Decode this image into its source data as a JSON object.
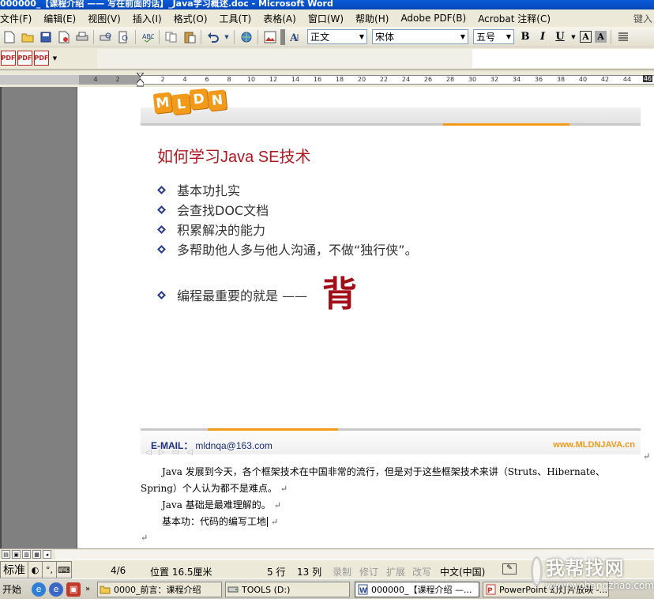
{
  "window": {
    "title": "000000_【课程介绍 —— 写在前面的话】_Java学习概述.doc - Microsoft Word"
  },
  "menu": {
    "items": [
      "文件(F)",
      "编辑(E)",
      "视图(V)",
      "插入(I)",
      "格式(O)",
      "工具(T)",
      "表格(A)",
      "窗口(W)",
      "帮助(H)",
      "Adobe PDF(B)",
      "Acrobat 注释(C)"
    ],
    "help_hint": "键入"
  },
  "toolbar": {
    "style_value": "正文",
    "font_value": "宋体",
    "size_value": "五号",
    "bold": "B",
    "italic": "I",
    "underline": "U",
    "char_border": "A",
    "char_shade": "A"
  },
  "ruler": {
    "ticks": [
      "4",
      "2",
      "2",
      "4",
      "6",
      "8",
      "10",
      "12",
      "14",
      "16",
      "18",
      "20",
      "22",
      "24",
      "26",
      "28",
      "30",
      "32",
      "34",
      "36",
      "38",
      "40",
      "42",
      "44"
    ],
    "end_mark": "46"
  },
  "slide": {
    "logo_letters": [
      "M",
      "L",
      "D",
      "N"
    ],
    "title": "如何学习Java SE技术",
    "bullets": [
      "基本功扎实",
      "会查找DOC文档",
      "积累解决的能力",
      "多帮助他人多与他人沟通，不做“独行侠”。"
    ],
    "emphasis_prefix": "编程最重要的就是 ——",
    "emphasis_char": "背",
    "footer_email_label": "E-MAIL：",
    "footer_email": "mldnqa@163.com",
    "footer_website": "www.MLDNJAVA.cn",
    "accent_color": "#f29a1a",
    "title_color": "#b0161e"
  },
  "body": {
    "para1_line1": "Java 发展到今天，各个框架技术在中国非常的流行，但是对于这些框架技术来讲（Struts、Hibernate、",
    "para1_line2": "Spring）个人认为都不是难点。",
    "para2": "Java 基础是最难理解的。",
    "para3": "基本功：代码的编写工地",
    "paragraph_mark": "↵"
  },
  "status": {
    "ime_label": "标准",
    "page_frac": "4/6",
    "position": "位置 16.5厘米",
    "line": "5 行",
    "col": "13 列",
    "rec": "录制",
    "trk": "修订",
    "ext": "扩展",
    "ovr": "改写",
    "lang": "中文(中国)"
  },
  "taskbar": {
    "start": "开始",
    "tasks": [
      "0000_前言：课程介绍",
      "TOOLS (D:)",
      "000000_【课程介绍 —...",
      "PowerPoint 幻灯片放映 -..."
    ]
  },
  "watermark": {
    "cn": "我帮找网",
    "url": "www.wobangzhao.com"
  }
}
